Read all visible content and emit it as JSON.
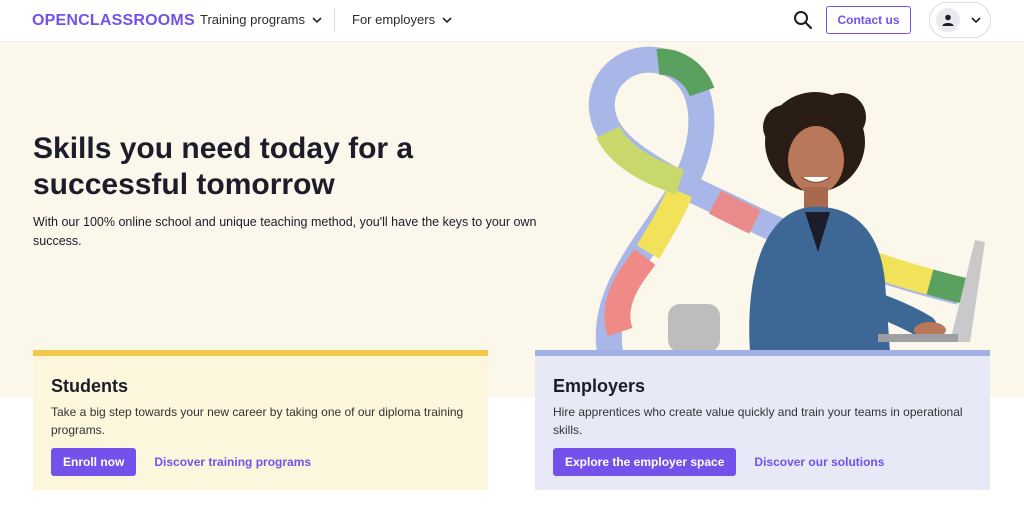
{
  "header": {
    "logo": "OPENCLASSROOMS",
    "nav": [
      {
        "label": "Training programs"
      },
      {
        "label": "For employers"
      }
    ],
    "contact_label": "Contact us"
  },
  "hero": {
    "title": "Skills you need today for a successful tomorrow",
    "subtitle": "With our 100% online school and unique teaching method, you'll have the keys to your own success."
  },
  "cards": {
    "students": {
      "title": "Students",
      "text": "Take a big step towards your new career by taking one of our diploma training programs.",
      "primary_label": "Enroll now",
      "link_label": "Discover training programs"
    },
    "employers": {
      "title": "Employers",
      "text": "Hire apprentices who create value quickly and train your teams in operational skills.",
      "primary_label": "Explore the employer space",
      "link_label": "Discover our solutions"
    }
  },
  "colors": {
    "brand": "#7451eb",
    "hero_bg": "#fbf7ea",
    "students_accent": "#f2c94c",
    "employers_accent": "#a3b0e4"
  },
  "icons": {
    "search": "search-icon",
    "user": "user-icon",
    "chevron": "chevron-down-icon"
  }
}
